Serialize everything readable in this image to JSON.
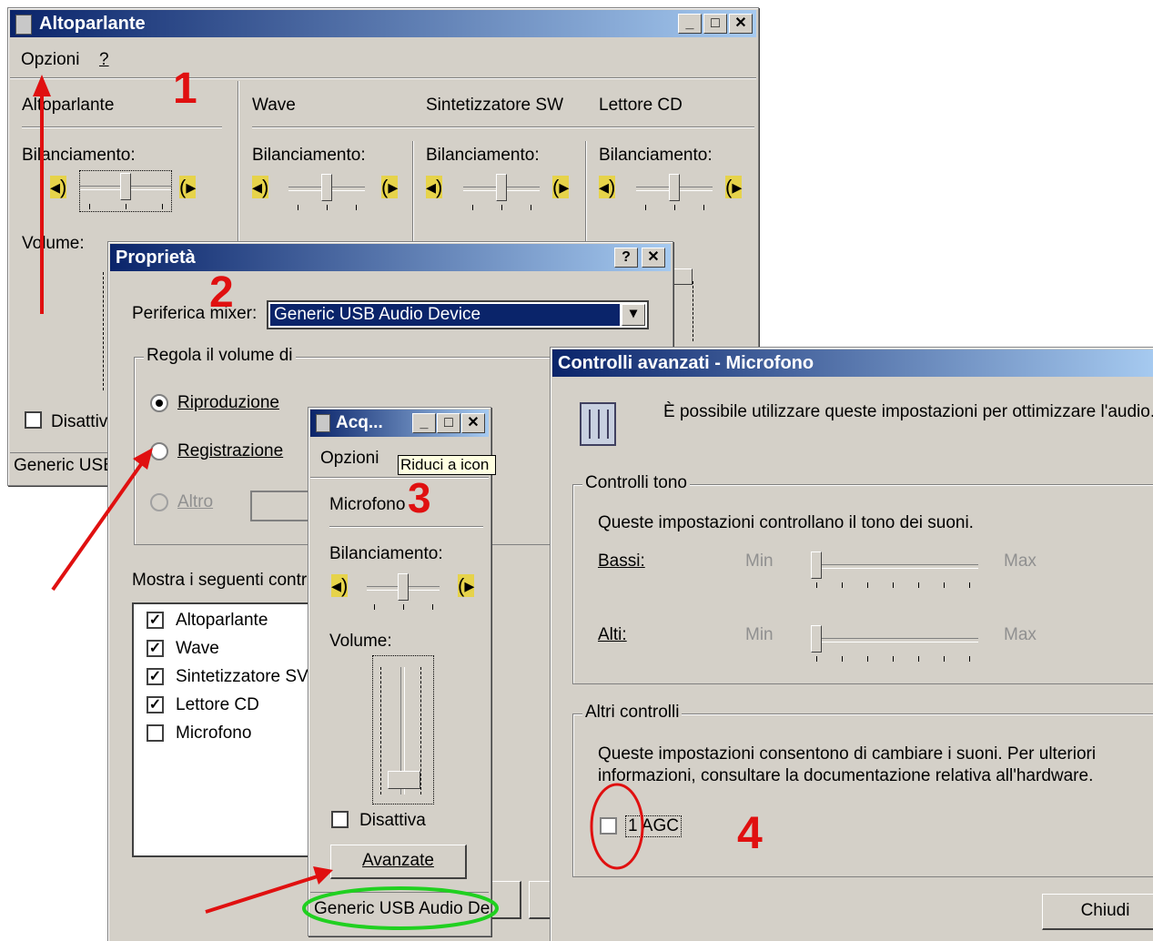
{
  "main_window": {
    "title": "Altoparlante",
    "menu": [
      "Opzioni",
      "?"
    ],
    "columns": [
      {
        "name": "Altoparlante"
      },
      {
        "name": "Wave"
      },
      {
        "name": "Sintetizzatore SW"
      },
      {
        "name": "Lettore CD"
      }
    ],
    "balance_label": "Bilanciamento:",
    "volume_label": "Volume:",
    "mute_label": "Disattiv",
    "status": "Generic USB"
  },
  "props_dialog": {
    "title": "Proprietà",
    "mixer_label": "Periferica mixer:",
    "mixer_value": "Generic USB Audio Device",
    "group_title": "Regola il volume di",
    "radio_playback": "Riproduzione",
    "radio_record": "Registrazione",
    "radio_other": "Altro",
    "show_label": "Mostra i seguenti contr",
    "list": [
      {
        "label": "Altoparlante",
        "checked": true
      },
      {
        "label": "Wave",
        "checked": true
      },
      {
        "label": "Sintetizzatore SV",
        "checked": true
      },
      {
        "label": "Lettore CD",
        "checked": true
      },
      {
        "label": "Microfono",
        "checked": false
      }
    ]
  },
  "rec_window": {
    "title": "Acq...",
    "menu": "Opzioni",
    "tooltip": "Riduci a icon",
    "channel": "Microfono",
    "balance_label": "Bilanciamento:",
    "volume_label": "Volume:",
    "mute_label": "Disattiva",
    "advanced_button": "Avanzate",
    "status": "Generic USB Audio De"
  },
  "advanced_dialog": {
    "title": "Controlli avanzati - Microfono",
    "description": "È possibile utilizzare queste impostazioni per ottimizzare l'audio.",
    "tone_group": "Controlli tono",
    "tone_text": "Queste impostazioni controllano il tono dei suoni.",
    "bass_label": "Bassi:",
    "treble_label": "Alti:",
    "min": "Min",
    "max": "Max",
    "other_group": "Altri controlli",
    "other_text_1": "Queste impostazioni consentono di cambiare i suoni. Per ulteriori",
    "other_text_2": "informazioni, consultare la documentazione relativa all'hardware.",
    "agc_label": "1 AGC",
    "close_button": "Chiudi"
  },
  "annotations": {
    "step1": "1",
    "step2": "2",
    "step3": "3",
    "step4": "4"
  },
  "colors": {
    "annotation_red": "#e01010",
    "highlight_green": "#20d020",
    "titlebar_blue": "#0a246a"
  }
}
